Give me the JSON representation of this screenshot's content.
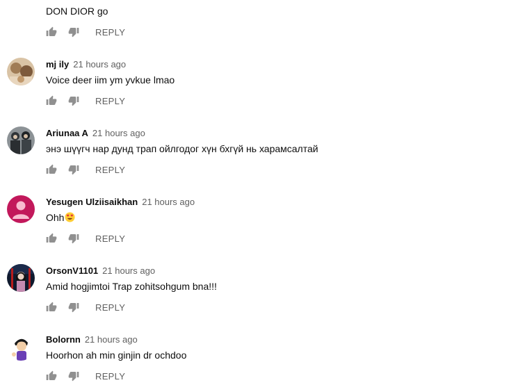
{
  "reply_label": "REPLY",
  "comments": [
    {
      "author": "",
      "time": "",
      "text": "DON DIOR go"
    },
    {
      "author": "mj ily",
      "time": "21 hours ago",
      "text": "Voice deer iim ym yvkue lmao"
    },
    {
      "author": "Ariunaa A",
      "time": "21 hours ago",
      "text": "энэ шүүгч нар дунд трап ойлгодог хүн бхгүй нь харамсалтай"
    },
    {
      "author": "Yesugen Ulziisaikhan",
      "time": "21 hours ago",
      "text": "Ohh",
      "emoji": "heart-eyes-emoji"
    },
    {
      "author": "OrsonV1101",
      "time": "21 hours ago",
      "text": "Amid hogjimtoi Trap zohitsohgum bna!!!"
    },
    {
      "author": "Bolornn",
      "time": "21 hours ago",
      "text": "Hoorhon ah min ginjin dr ochdoo"
    }
  ],
  "colors": {
    "default_avatar": "#c2185b",
    "meta_gray": "#606060",
    "icon_gray": "#909090"
  },
  "icons": [
    "thumb-up-icon",
    "thumb-down-icon"
  ]
}
